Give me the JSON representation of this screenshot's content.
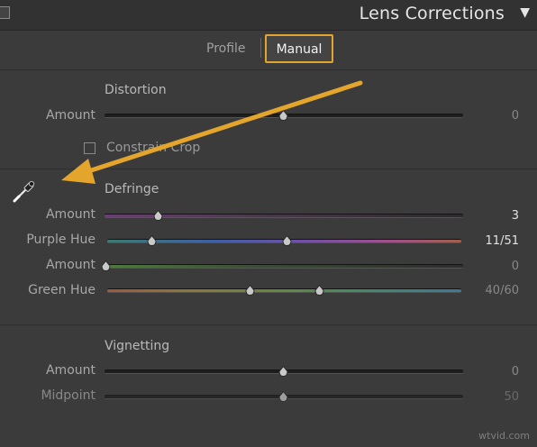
{
  "header": {
    "title": "Lens Corrections",
    "caret": "▼"
  },
  "tabs": {
    "profile": "Profile",
    "manual": "Manual"
  },
  "distortion": {
    "title": "Distortion",
    "amount_label": "Amount",
    "amount_value": "0",
    "amount_position": 0.5,
    "constrain_crop_label": "Constrain Crop"
  },
  "defringe": {
    "title": "Defringe",
    "purple_amount_label": "Amount",
    "purple_amount_value": "3",
    "purple_amount_position": 0.15,
    "purple_hue_label": "Purple Hue",
    "purple_hue_value": "11/51",
    "purple_hue_low": 0.126,
    "purple_hue_high": 0.508,
    "green_amount_label": "Amount",
    "green_amount_value": "0",
    "green_amount_position": 0.0,
    "green_hue_label": "Green Hue",
    "green_hue_value": "40/60",
    "green_hue_low": 0.405,
    "green_hue_high": 0.6
  },
  "vignetting": {
    "title": "Vignetting",
    "amount_label": "Amount",
    "amount_value": "0",
    "amount_position": 0.5,
    "midpoint_label": "Midpoint",
    "midpoint_value": "50",
    "midpoint_position": 0.5
  },
  "icons": {
    "eyedropper": "eyedropper-icon",
    "annotation": "arrow-annotation"
  },
  "colors": {
    "highlight": "#e3a52b"
  },
  "watermark": "wtvid.com"
}
